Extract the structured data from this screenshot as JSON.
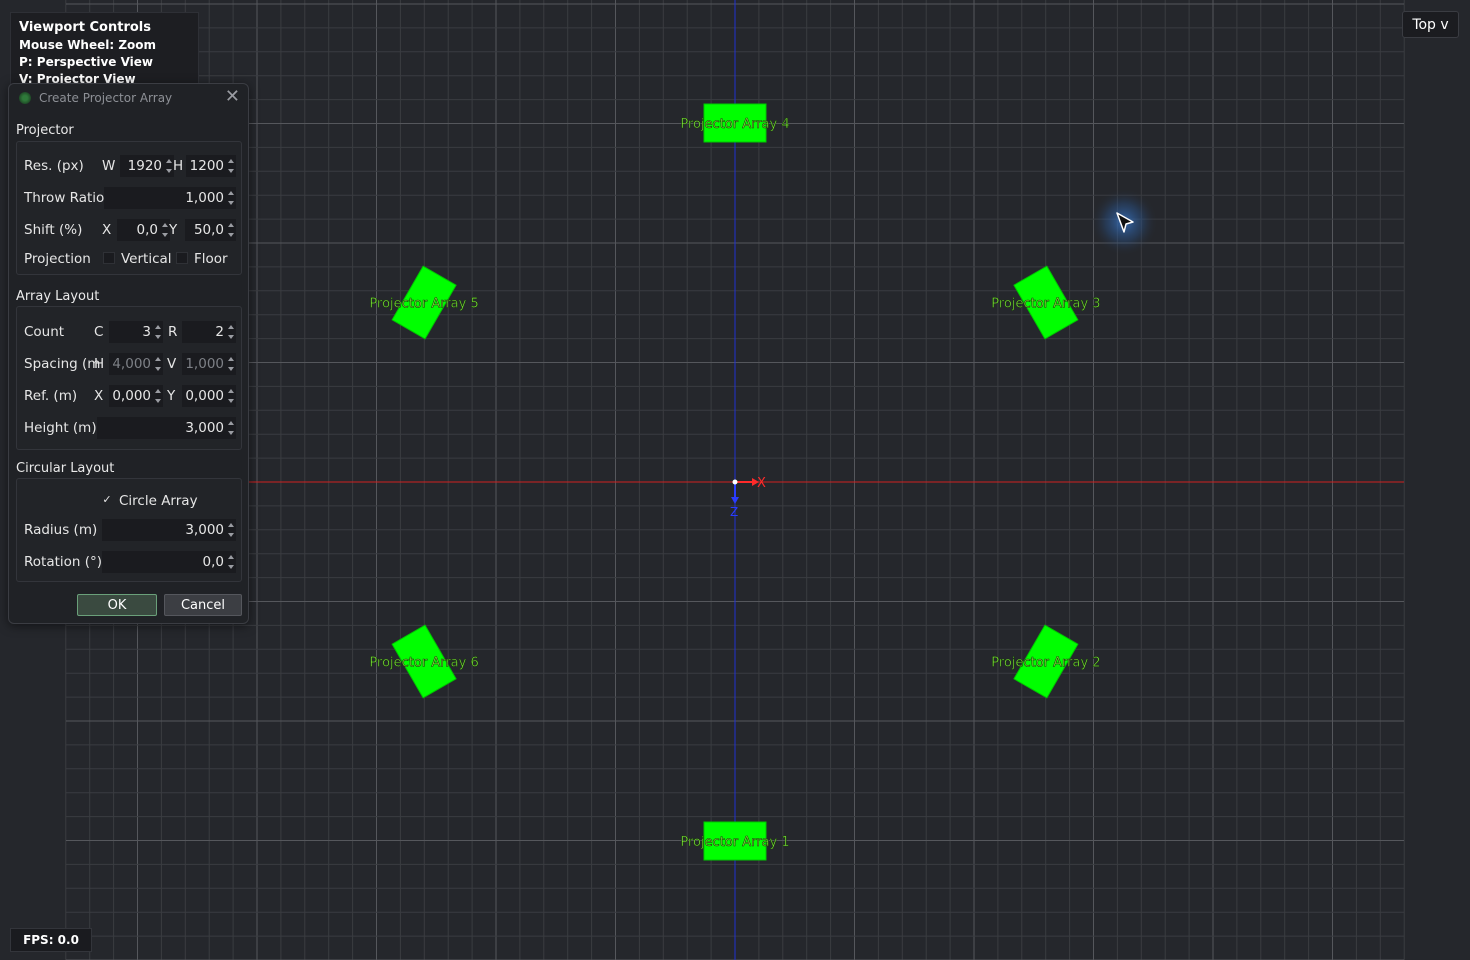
{
  "viewport_help": {
    "title": "Viewport Controls",
    "lines": [
      "Mouse Wheel: Zoom",
      "P: Perspective View",
      "V: Projector View"
    ]
  },
  "view_selector": {
    "label": "Top v"
  },
  "fps": "FPS: 0.0",
  "scene": {
    "projectors": [
      {
        "label": "Projector Array 1",
        "angle_deg": 0
      },
      {
        "label": "Projector Array 2",
        "angle_deg": 60
      },
      {
        "label": "Projector Array 3",
        "angle_deg": 120
      },
      {
        "label": "Projector Array 4",
        "angle_deg": 180
      },
      {
        "label": "Projector Array 5",
        "angle_deg": 240
      },
      {
        "label": "Projector Array 6",
        "angle_deg": 300
      }
    ],
    "axis_labels": {
      "x": "X",
      "z": "Z"
    },
    "colors": {
      "background": "#25272c",
      "grid": "#3a3c41",
      "grid_major": "#55575c",
      "x_axis": "#d02020",
      "z_axis": "#2030d0",
      "projector": "#00ff00",
      "projector_label": "#8cff3c"
    }
  },
  "dialog": {
    "title": "Create Projector Array",
    "projector_section": "Projector",
    "res_label": "Res. (px)",
    "w_label": "W",
    "width": "1920",
    "h_label": "H",
    "height": "1200",
    "throw_label": "Throw Ratio",
    "throw": "1,000",
    "shift_label": "Shift (%)",
    "shift_x_label": "X",
    "shift_x": "0,0",
    "shift_y_label": "Y",
    "shift_y": "50,0",
    "projection_label": "Projection",
    "vertical_label": "Vertical",
    "floor_label": "Floor",
    "array_section": "Array Layout",
    "count_label": "Count",
    "c_label": "C",
    "count_c": "3",
    "r_label": "R",
    "count_r": "2",
    "spacing_label": "Spacing (m",
    "spacing_h_label": "H",
    "spacing_h": "4,000",
    "spacing_v_label": "V",
    "spacing_v": "1,000",
    "ref_label": "Ref. (m)",
    "ref_x_label": "X",
    "ref_x": "0,000",
    "ref_y_label": "Y",
    "ref_y": "0,000",
    "height_label": "Height (m)",
    "height_m": "3,000",
    "circular_section": "Circular Layout",
    "circle_array_label": "Circle Array",
    "circle_array_checked": "✓",
    "radius_label": "Radius (m)",
    "radius": "3,000",
    "rotation_label": "Rotation (°)",
    "rotation": "0,0",
    "ok_label": "OK",
    "cancel_label": "Cancel"
  }
}
